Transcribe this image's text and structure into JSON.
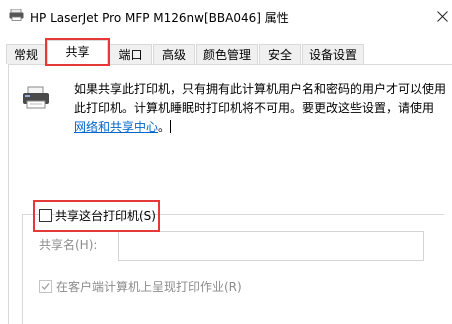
{
  "window": {
    "title": "HP LaserJet Pro MFP M126nw[BBA046] 属性",
    "app_icon": "printer-app-icon",
    "close_icon": "close-icon"
  },
  "tabs": [
    {
      "label": "常规",
      "active": false
    },
    {
      "label": "共享",
      "active": true
    },
    {
      "label": "端口",
      "active": false
    },
    {
      "label": "高级",
      "active": false
    },
    {
      "label": "颜色管理",
      "active": false
    },
    {
      "label": "安全",
      "active": false
    },
    {
      "label": "设备设置",
      "active": false
    }
  ],
  "sharing": {
    "description_text": "如果共享此打印机，只有拥有此计算机用户名和密码的用户才可以使用此打印机。计算机睡眠时打印机将不可用。要更改这些设置，请使用",
    "network_link": "网络和共享中心",
    "description_suffix": "。",
    "printer_icon": "printer-icon",
    "share_checkbox_label": "共享这台打印机(S)",
    "share_checked": false,
    "share_name_label": "共享名(H):",
    "share_name_value": "",
    "render_checkbox_label": "在客户端计算机上呈现打印作业(R)",
    "render_checked": true
  },
  "colors": {
    "highlight": "#e53935",
    "link": "#0066cc",
    "disabled_text": "#8c8c8c"
  }
}
